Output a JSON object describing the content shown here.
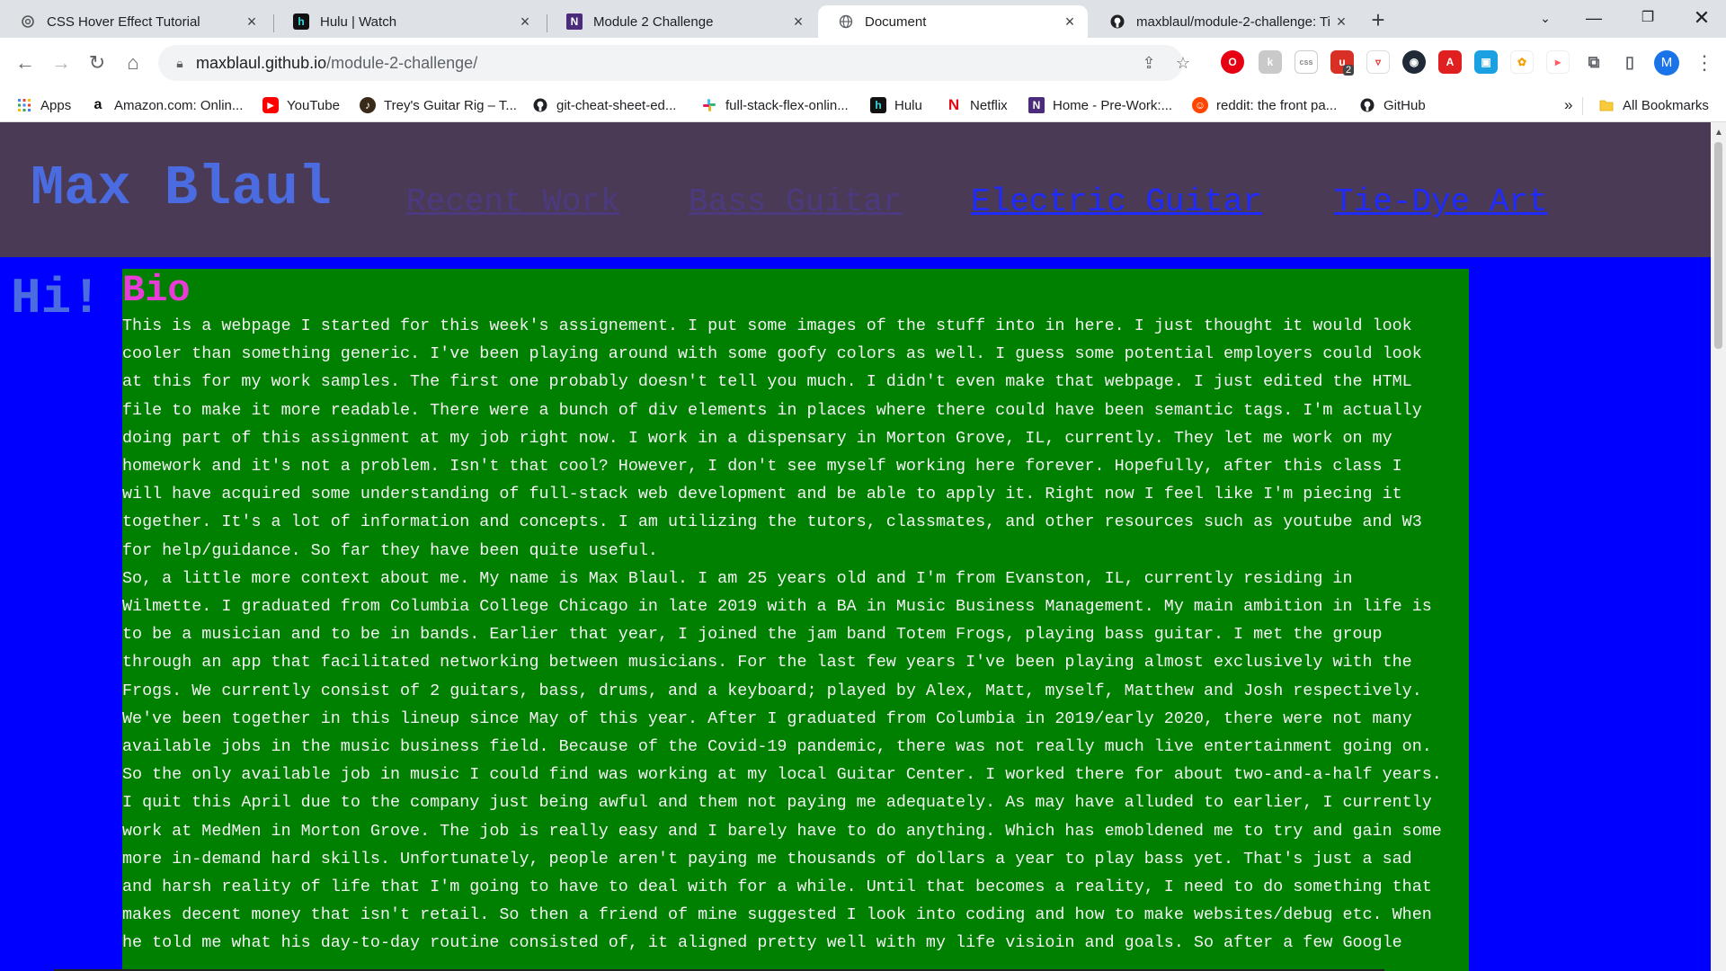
{
  "browser": {
    "tabs": [
      {
        "title": "CSS Hover Effect Tutorial",
        "icon": "openai-icon"
      },
      {
        "title": "Hulu | Watch",
        "icon": "hulu-icon"
      },
      {
        "title": "Module 2 Challenge",
        "icon": "n-icon"
      },
      {
        "title": "Document",
        "icon": "globe-icon"
      },
      {
        "title": "maxblaul/module-2-challenge: Ti",
        "icon": "github-icon"
      }
    ],
    "active_tab_index": 3,
    "url_host": "maxblaul.github.io",
    "url_path": "/module-2-challenge/",
    "profile_initial": "M",
    "extension_badge": "2",
    "bookmarks": [
      {
        "label": "Apps",
        "icon": "apps-grid-icon"
      },
      {
        "label": "Amazon.com: Onlin...",
        "icon": "amazon-icon"
      },
      {
        "label": "YouTube",
        "icon": "youtube-icon"
      },
      {
        "label": "Trey's Guitar Rig – T...",
        "icon": "guitar-icon"
      },
      {
        "label": "git-cheat-sheet-ed...",
        "icon": "github-icon"
      },
      {
        "label": "full-stack-flex-onlin...",
        "icon": "slack-icon"
      },
      {
        "label": "Hulu",
        "icon": "hulu-icon"
      },
      {
        "label": "Netflix",
        "icon": "netflix-icon"
      },
      {
        "label": "Home - Pre-Work:...",
        "icon": "n-icon"
      },
      {
        "label": "reddit: the front pa...",
        "icon": "reddit-icon"
      },
      {
        "label": "GitHub",
        "icon": "github-icon"
      }
    ],
    "overflow_label": "»",
    "all_bookmarks_label": "All Bookmarks"
  },
  "page": {
    "site_name": "Max Blaul",
    "nav": [
      "Recent Work",
      "Bass Guitar",
      "Electric Guitar",
      "Tie-Dye Art"
    ],
    "greeting": "Hi!",
    "bio_heading": "Bio",
    "bio_lines": [
      "This is a webpage I started for this week's assignement. I put some images of the stuff into in here. I just thought it would look",
      "cooler than something generic. I've been playing around with some goofy colors as well. I guess some potential employers could look",
      "at this for my work samples. The first one probably doesn't tell you much. I didn't even make that webpage. I just edited the HTML",
      "file to make it more readable. There were a bunch of div elements in places where there could have been semantic tags. I'm actually",
      "doing part of this assignment at my job right now. I work in a dispensary in Morton Grove, IL, currently. They let me work on my",
      "homework and it's not a problem. Isn't that cool? However, I don't see myself working here forever. Hopefully, after this class I",
      "will have acquired some understanding of full-stack web development and be able to apply it. Right now I feel like I'm piecing it",
      "together. It's a lot of information and concepts. I am utilizing the tutors, classmates, and other resources such as youtube and W3",
      "for help/guidance. So far they have been quite useful.",
      "So, a little more context about me. My name is Max Blaul. I am 25 years old and I'm from Evanston, IL, currently residing in",
      "Wilmette. I graduated from Columbia College Chicago in late 2019 with a BA in Music Business Management. My main ambition in life is",
      "to be a musician and to be in bands. Earlier that year, I joined the jam band Totem Frogs, playing bass guitar. I met the group",
      "through an app that facilitated networking between musicians. For the last few years I've been playing almost exclusively with the",
      "Frogs. We currently consist of 2 guitars, bass, drums, and a keyboard; played by Alex, Matt, myself, Matthew and Josh respectively.",
      "We've been together in this lineup since May of this year. After I graduated from Columbia in 2019/early 2020, there were not many",
      "available jobs in the music business field. Because of the Covid-19 pandemic, there was not really much live entertainment going on.",
      "So the only available job in music I could find was working at my local Guitar Center. I worked there for about two-and-a-half years.",
      "I quit this April due to the company just being awful and them not paying me adequately. As may have alluded to earlier, I currently",
      "work at MedMen in Morton Grove. The job is really easy and I barely have to do anything. Which has emobldened me to try and gain some",
      "more in-demand hard skills. Unfortunately, people aren't paying me thousands of dollars a year to play bass yet. That's just a sad",
      "and harsh reality of life that I'm going to have to deal with for a while. Until that becomes a reality, I need to do something that",
      "makes decent money that isn't retail. So then a friend of mine suggested I look into coding and how to make websites/debug etc. When",
      "he told me what his day-to-day routine consisted of, it aligned pretty well with my life visioin and goals. So after a few Google"
    ],
    "colors": {
      "page_bg": "#0000ff",
      "header_bg": "#4b3a55",
      "bio_bg": "#008000",
      "bio_heading": "#e83bd7",
      "site_name": "#4a6ce0"
    }
  }
}
